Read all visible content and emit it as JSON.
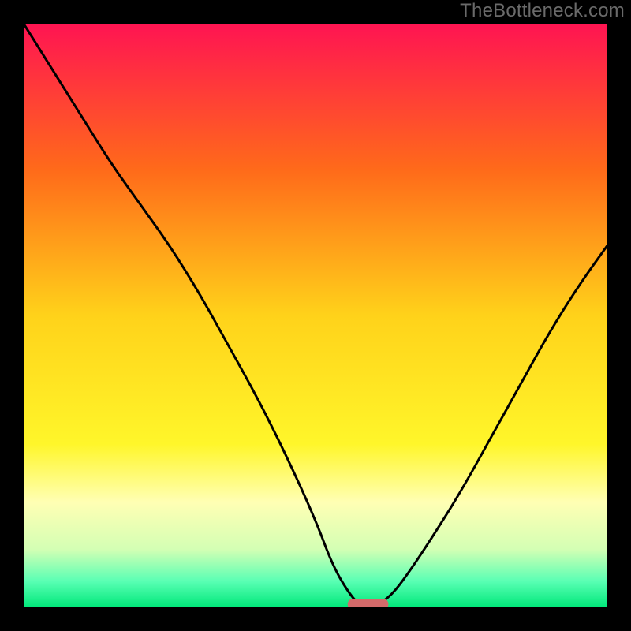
{
  "watermark": "TheBottleneck.com",
  "chart_data": {
    "type": "line",
    "title": "",
    "xlabel": "",
    "ylabel": "",
    "xlim": [
      0,
      100
    ],
    "ylim": [
      0,
      100
    ],
    "grid": false,
    "legend": false,
    "x": [
      0,
      5,
      10,
      15,
      20,
      25,
      30,
      35,
      40,
      45,
      50,
      53,
      56,
      58,
      60,
      63,
      66,
      70,
      75,
      80,
      85,
      90,
      95,
      100
    ],
    "values": [
      100,
      92,
      84,
      76,
      69,
      62,
      54,
      45,
      36,
      26,
      15,
      7,
      2,
      0,
      0,
      2,
      6,
      12,
      20,
      29,
      38,
      47,
      55,
      62
    ],
    "marker": {
      "x_center": 59,
      "width": 7,
      "y": 0
    },
    "gradient_stops": [
      {
        "offset": 0,
        "color": "#ff1452"
      },
      {
        "offset": 0.25,
        "color": "#ff6a1a"
      },
      {
        "offset": 0.5,
        "color": "#ffd21a"
      },
      {
        "offset": 0.72,
        "color": "#fff62a"
      },
      {
        "offset": 0.82,
        "color": "#ffffb4"
      },
      {
        "offset": 0.9,
        "color": "#d4ffb4"
      },
      {
        "offset": 0.955,
        "color": "#5affb4"
      },
      {
        "offset": 1.0,
        "color": "#00e87a"
      }
    ],
    "border_color": "#000000",
    "border_width_px": 30,
    "marker_color": "#d36a6a"
  }
}
